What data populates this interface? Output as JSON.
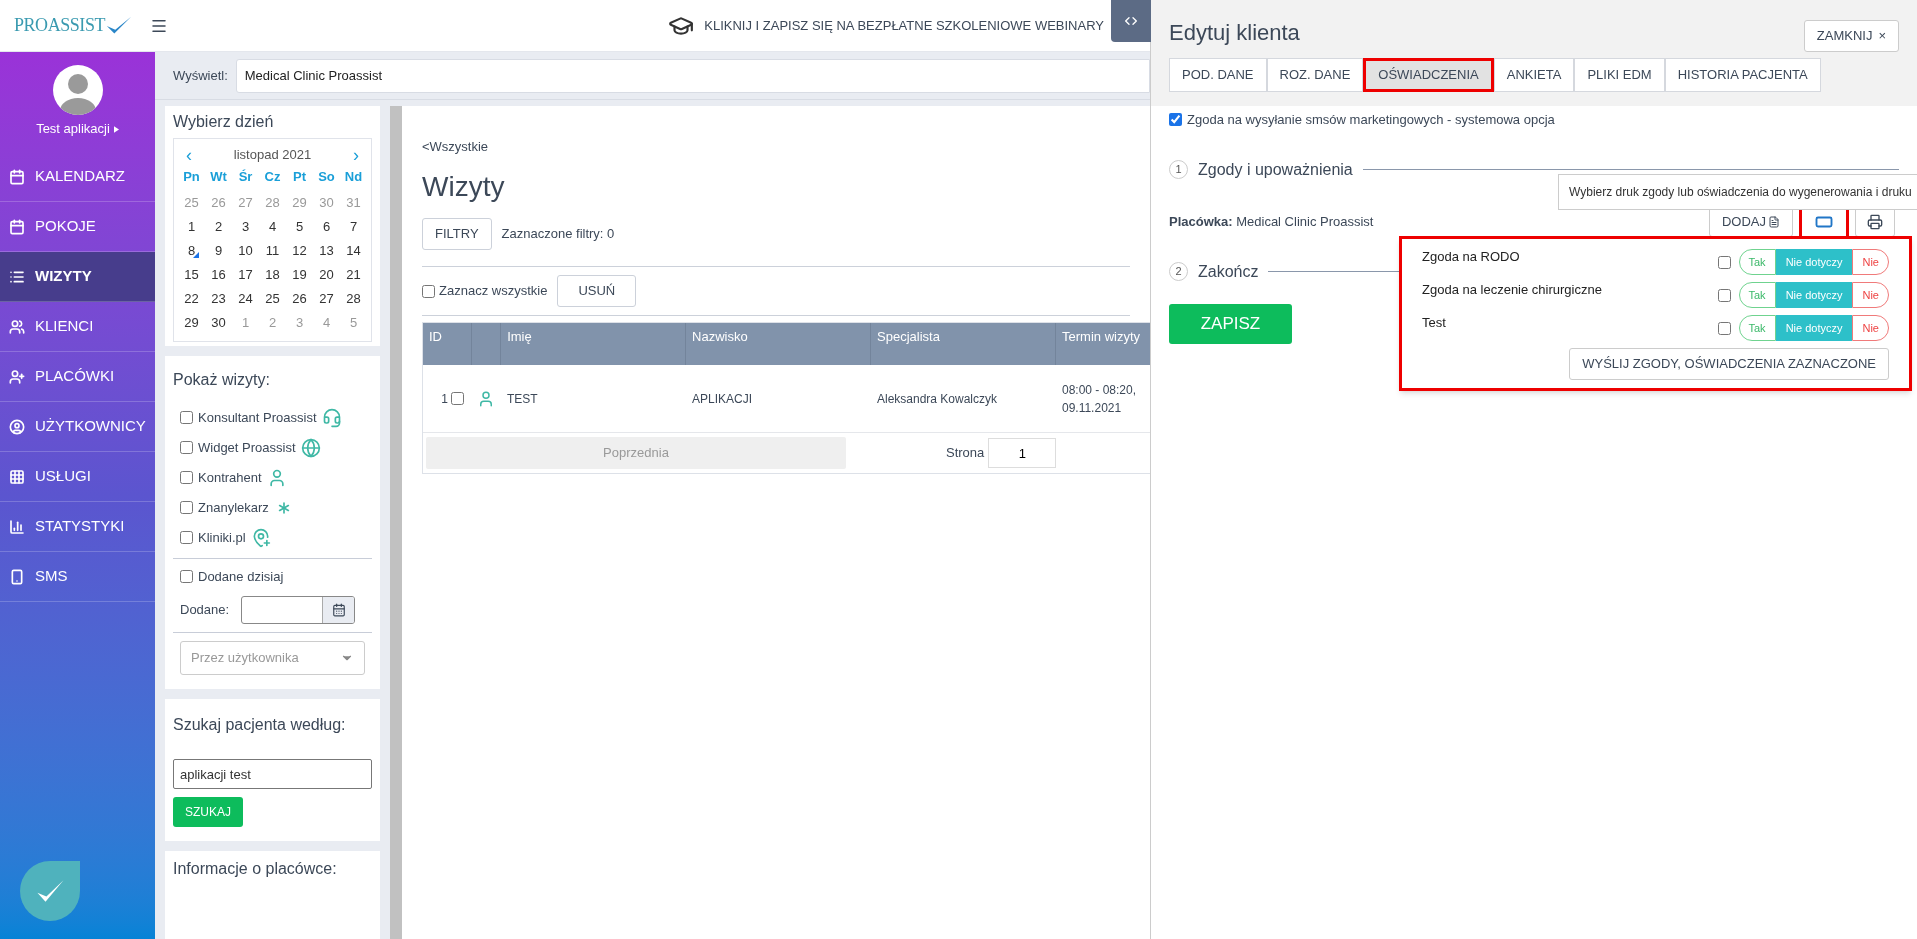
{
  "topbar": {
    "logo": "PROASSIST",
    "banner": "KLIKNIJ I ZAPISZ SIĘ NA BEZPŁATNE SZKOLENIOWE WEBINARY"
  },
  "sidebar": {
    "user": "Test aplikacji",
    "items": [
      {
        "label": "KALENDARZ",
        "kind": "calendar",
        "selected": false
      },
      {
        "label": "POKOJE",
        "kind": "calendar",
        "selected": false
      },
      {
        "label": "WIZYTY",
        "kind": "list",
        "selected": true
      },
      {
        "label": "KLIENCI",
        "kind": "users",
        "selected": false
      },
      {
        "label": "PLACÓWKI",
        "kind": "staff",
        "selected": false
      },
      {
        "label": "UŻYTKOWNICY",
        "kind": "accounts",
        "selected": false
      },
      {
        "label": "USŁUGI",
        "kind": "services",
        "selected": false
      },
      {
        "label": "STATYSTYKI",
        "kind": "stats",
        "selected": false
      },
      {
        "label": "SMS",
        "kind": "sms",
        "selected": false
      }
    ]
  },
  "display": {
    "label": "Wyświetl:",
    "value": "Medical Clinic Proassist"
  },
  "calendar": {
    "title": "Wybierz dzień",
    "prev": "‹",
    "month": "listopad 2021",
    "next": "›",
    "weekdays": [
      "Pn",
      "Wt",
      "Śr",
      "Cz",
      "Pt",
      "So",
      "Nd"
    ],
    "days": [
      {
        "d": "25",
        "other": true,
        "today": false
      },
      {
        "d": "26",
        "other": true,
        "today": false
      },
      {
        "d": "27",
        "other": true,
        "today": false
      },
      {
        "d": "28",
        "other": true,
        "today": false
      },
      {
        "d": "29",
        "other": true,
        "today": false
      },
      {
        "d": "30",
        "other": true,
        "today": false
      },
      {
        "d": "31",
        "other": true,
        "today": false
      },
      {
        "d": "1",
        "other": false,
        "today": false
      },
      {
        "d": "2",
        "other": false,
        "today": false
      },
      {
        "d": "3",
        "other": false,
        "today": false
      },
      {
        "d": "4",
        "other": false,
        "today": false
      },
      {
        "d": "5",
        "other": false,
        "today": false
      },
      {
        "d": "6",
        "other": false,
        "today": false
      },
      {
        "d": "7",
        "other": false,
        "today": false
      },
      {
        "d": "8",
        "other": false,
        "today": true
      },
      {
        "d": "9",
        "other": false,
        "today": false
      },
      {
        "d": "10",
        "other": false,
        "today": false
      },
      {
        "d": "11",
        "other": false,
        "today": false
      },
      {
        "d": "12",
        "other": false,
        "today": false
      },
      {
        "d": "13",
        "other": false,
        "today": false
      },
      {
        "d": "14",
        "other": false,
        "today": false
      },
      {
        "d": "15",
        "other": false,
        "today": false
      },
      {
        "d": "16",
        "other": false,
        "today": false
      },
      {
        "d": "17",
        "other": false,
        "today": false
      },
      {
        "d": "18",
        "other": false,
        "today": false
      },
      {
        "d": "19",
        "other": false,
        "today": false
      },
      {
        "d": "20",
        "other": false,
        "today": false
      },
      {
        "d": "21",
        "other": false,
        "today": false
      },
      {
        "d": "22",
        "other": false,
        "today": false
      },
      {
        "d": "23",
        "other": false,
        "today": false
      },
      {
        "d": "24",
        "other": false,
        "today": false
      },
      {
        "d": "25",
        "other": false,
        "today": false
      },
      {
        "d": "26",
        "other": false,
        "today": false
      },
      {
        "d": "27",
        "other": false,
        "today": false
      },
      {
        "d": "28",
        "other": false,
        "today": false
      },
      {
        "d": "29",
        "other": false,
        "today": false
      },
      {
        "d": "30",
        "other": false,
        "today": false
      },
      {
        "d": "1",
        "other": true,
        "today": false
      },
      {
        "d": "2",
        "other": true,
        "today": false
      },
      {
        "d": "3",
        "other": true,
        "today": false
      },
      {
        "d": "4",
        "other": true,
        "today": false
      },
      {
        "d": "5",
        "other": true,
        "today": false
      }
    ]
  },
  "show_visits": {
    "title": "Pokaż wizyty:",
    "sources": [
      {
        "label": "Konsultant Proassist",
        "kind": "consultant",
        "checked": false
      },
      {
        "label": "Widget Proassist",
        "kind": "widget",
        "checked": false
      },
      {
        "label": "Kontrahent",
        "kind": "contractor",
        "checked": false
      },
      {
        "label": "Znanylekarz",
        "kind": "directory",
        "checked": false
      },
      {
        "label": "Kliniki.pl",
        "kind": "clinics",
        "checked": false
      }
    ],
    "added_today": {
      "label": "Dodane dzisiaj",
      "checked": false
    },
    "added_label": "Dodane:",
    "user_select": {
      "placeholder": "Przez użytkownika"
    }
  },
  "search": {
    "title": "Szukaj pacjenta według:",
    "value": "aplikacji test",
    "button": "SZUKAJ"
  },
  "info_title": "Informacje o placówce:",
  "main": {
    "back_link": "<Wszystkie",
    "title": "Wizyty",
    "filters_button": "FILTRY",
    "filters_text": "Zaznaczone filtry: 0",
    "select_all": {
      "label": "Zaznacz wszystkie",
      "checked": false
    },
    "delete_button": "USUŃ",
    "table": {
      "columns": [
        "ID",
        "Imię",
        "Nazwisko",
        "Specjalista",
        "Termin wizyty"
      ],
      "rows": [
        {
          "id": "1",
          "checked": false,
          "first_name": "TEST",
          "last_name": "APLIKACJI",
          "specialist": "Aleksandra Kowalczyk",
          "term": "08:00 - 08:20, 09.11.2021"
        }
      ]
    },
    "pagination": {
      "prev": "Poprzednia",
      "page_label": "Strona",
      "page": "1"
    }
  },
  "panel": {
    "title": "Edytuj klienta",
    "close": "ZAMKNIJ",
    "close_icon": "×",
    "tabs": [
      {
        "label": "POD. DANE",
        "selected": false,
        "highlighted": false
      },
      {
        "label": "ROZ. DANE",
        "selected": false,
        "highlighted": false
      },
      {
        "label": "OŚWIADCZENIA",
        "selected": true,
        "highlighted": true
      },
      {
        "label": "ANKIETA",
        "selected": false,
        "highlighted": false
      },
      {
        "label": "PLIKI EDM",
        "selected": false,
        "highlighted": false
      },
      {
        "label": "HISTORIA PACJENTA",
        "selected": false,
        "highlighted": false
      }
    ],
    "sms_consent": {
      "label": "Zgoda na wysyłanie smsów marketingowych - systemowa opcja",
      "checked": true
    },
    "steps": [
      {
        "number": "1",
        "title": "Zgody i upoważnienia"
      },
      {
        "number": "2",
        "title": "Zakończ"
      }
    ],
    "facility": "**Placówka:** Medical Clinic Proassist",
    "add_button": "DODAJ",
    "print_select_highlighted": true,
    "tooltip": "Wybierz druk zgody lub oświadczenia do wygenerowania i druku",
    "save_button": "ZAPISZ",
    "popup": {
      "highlighted": true,
      "consents": [
        {
          "label": "Zgoda na RODO",
          "checked": false,
          "options": [
            {
              "label": "Tak",
              "kind": "yes",
              "selected": false
            },
            {
              "label": "Nie dotyczy",
              "kind": "na",
              "selected": true
            },
            {
              "label": "Nie",
              "kind": "no",
              "selected": false
            }
          ]
        },
        {
          "label": "Zgoda na leczenie chirurgiczne",
          "checked": false,
          "options": [
            {
              "label": "Tak",
              "kind": "yes",
              "selected": false
            },
            {
              "label": "Nie dotyczy",
              "kind": "na",
              "selected": true
            },
            {
              "label": "Nie",
              "kind": "no",
              "selected": false
            }
          ]
        },
        {
          "label": "Test",
          "checked": false,
          "options": [
            {
              "label": "Tak",
              "kind": "yes",
              "selected": false
            },
            {
              "label": "Nie dotyczy",
              "kind": "na",
              "selected": true
            },
            {
              "label": "Nie",
              "kind": "no",
              "selected": false
            }
          ]
        }
      ],
      "send_button": "WYŚLIJ ZGODY, OŚWIADCZENIA ZAZNACZONE"
    }
  }
}
